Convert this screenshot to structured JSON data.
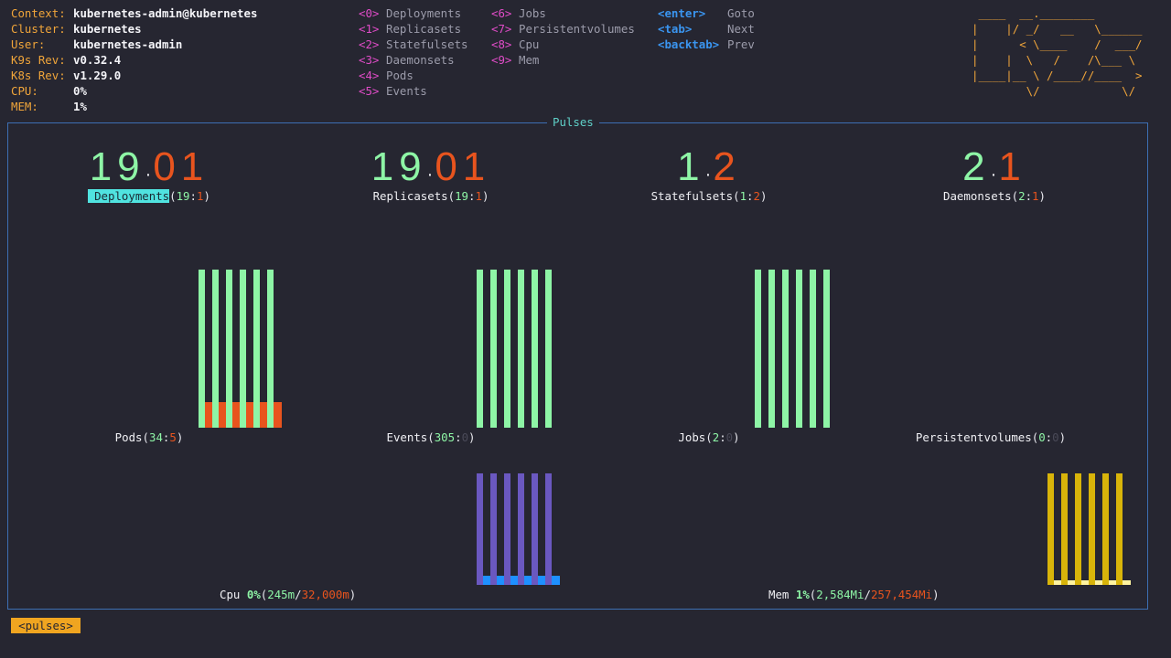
{
  "info": [
    {
      "key": "Context:",
      "value": "kubernetes-admin@kubernetes"
    },
    {
      "key": "Cluster:",
      "value": "kubernetes"
    },
    {
      "key": "User:",
      "value": "kubernetes-admin"
    },
    {
      "key": "K9s Rev:",
      "value": "v0.32.4"
    },
    {
      "key": "K8s Rev:",
      "value": "v1.29.0"
    },
    {
      "key": "CPU:",
      "value": "0%"
    },
    {
      "key": "MEM:",
      "value": "1%"
    }
  ],
  "nav_col1": [
    {
      "key": "<0>",
      "label": "Deployments"
    },
    {
      "key": "<1>",
      "label": "Replicasets"
    },
    {
      "key": "<2>",
      "label": "Statefulsets"
    },
    {
      "key": "<3>",
      "label": "Daemonsets"
    },
    {
      "key": "<4>",
      "label": "Pods"
    },
    {
      "key": "<5>",
      "label": "Events"
    }
  ],
  "nav_col2": [
    {
      "key": "<6>",
      "label": "Jobs"
    },
    {
      "key": "<7>",
      "label": "Persistentvolumes"
    },
    {
      "key": "<8>",
      "label": "Cpu"
    },
    {
      "key": "<9>",
      "label": "Mem"
    }
  ],
  "nav_col3": [
    {
      "key": "<enter>",
      "label": "Goto"
    },
    {
      "key": "<tab>",
      "label": "Next"
    },
    {
      "key": "<backtab>",
      "label": "Prev"
    }
  ],
  "logo": " ____  __.________       \n|    |/ _/   __   \\______\n|      < \\____    /  ___/\n|    |  \\   /    /\\___ \\ \n|____|__ \\ /____//____  >\n        \\/            \\/ ",
  "panel_title": "Pulses",
  "gauges": [
    {
      "name": "Deployments",
      "ok": "19",
      "fail": "1",
      "ok_digits": "19",
      "fail_digits": "01",
      "selected": true
    },
    {
      "name": "Replicasets",
      "ok": "19",
      "fail": "1",
      "ok_digits": "19",
      "fail_digits": "01"
    },
    {
      "name": "Statefulsets",
      "ok": "1",
      "fail": "2",
      "ok_digits": "1",
      "fail_digits": "2"
    },
    {
      "name": "Daemonsets",
      "ok": "2",
      "fail": "1",
      "ok_digits": "2",
      "fail_digits": "1"
    }
  ],
  "sparks": [
    {
      "name": "Pods",
      "ok": "34",
      "fail": "5",
      "ok_level": 1.0,
      "fail_level": 0.16
    },
    {
      "name": "Events",
      "ok": "305",
      "fail": "0",
      "ok_level": 1.0,
      "fail_level": 0
    },
    {
      "name": "Jobs",
      "ok": "2",
      "fail": "0",
      "ok_level": 1.0,
      "fail_level": 0
    },
    {
      "name": "Persistentvolumes",
      "ok": "0",
      "fail": "0",
      "ok_level": 0,
      "fail_level": 0
    }
  ],
  "cpu": {
    "name": "Cpu",
    "pct": "0%",
    "used": "245m",
    "total": "32,000m"
  },
  "mem": {
    "name": "Mem",
    "pct": "1%",
    "used": "2,584Mi",
    "total": "257,454Mi"
  },
  "colors": {
    "ok": "#8ef5a6",
    "fail": "#e8541e",
    "cpu": "#6a58c0",
    "cpu_base": "#1e90ff",
    "mem": "#d8b40a",
    "mem_base": "#fff3a0"
  },
  "footer_badge": "<pulses>"
}
